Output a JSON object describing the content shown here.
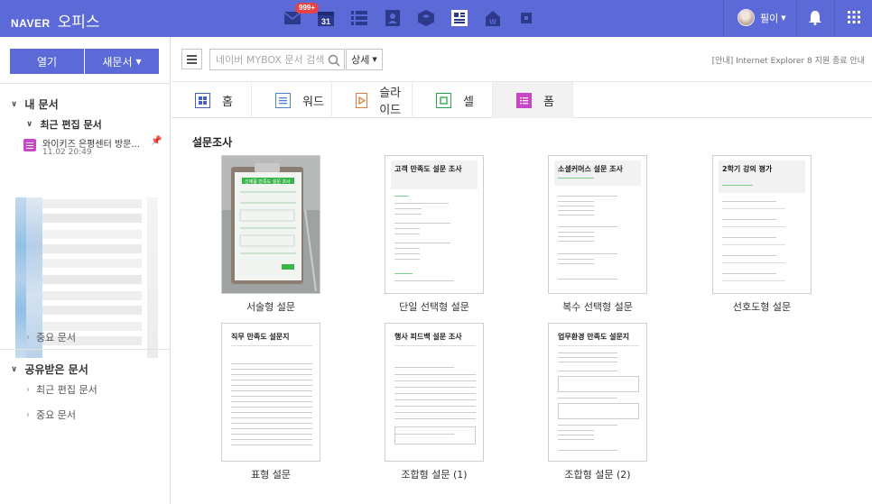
{
  "topbar": {
    "brand": "NAVER",
    "product": "오피스",
    "mail_badge": "999+",
    "calendar_day": "31",
    "username": "필이",
    "apps": [
      "mail-icon",
      "calendar-icon",
      "memo-icon",
      "contacts-icon",
      "mybox-icon",
      "office-icon",
      "works-icon",
      "more-apps-icon"
    ],
    "colors": {
      "bar": "#5b6ad6",
      "badge": "#e84242"
    }
  },
  "sidebar": {
    "open_label": "열기",
    "new_label": "새문서",
    "my_docs": "내 문서",
    "recent_edited": "최근 편집 문서",
    "recent_item": {
      "name": "와이키즈 은평센터 방문...",
      "date": "11.02 20:49"
    },
    "important_docs": "중요 문서",
    "shared_docs": "공유받은 문서",
    "shared_recent": "최근 편집 문서",
    "shared_important": "중요 문서"
  },
  "toolbar": {
    "search_placeholder": "네이버 MYBOX 문서 검색",
    "detail_label": "상세",
    "notice": "[안내] Internet Explorer 8 지원 종료 안내"
  },
  "tabs": [
    {
      "label": "홈",
      "icon": "home-icon",
      "color": "#4a5fc1"
    },
    {
      "label": "워드",
      "icon": "word-icon",
      "color": "#4a83d4"
    },
    {
      "label": "슬라이드",
      "icon": "slide-icon",
      "color": "#e0793b"
    },
    {
      "label": "셀",
      "icon": "cell-icon",
      "color": "#27a34a"
    },
    {
      "label": "폼",
      "icon": "form-icon",
      "color": "#c847c9"
    }
  ],
  "content": {
    "category": "설문조사",
    "templates": [
      {
        "label": "서술형 설문",
        "thumb_title": "신제품 만족도 설문 조사"
      },
      {
        "label": "단일 선택형 설문",
        "thumb_title": "고객 만족도 설문 조사"
      },
      {
        "label": "복수 선택형 설문",
        "thumb_title": "소셜커머스 설문 조사"
      },
      {
        "label": "선호도형 설문",
        "thumb_title": "2학기 강의 평가"
      },
      {
        "label": "표형 설문",
        "thumb_title": "직무 만족도 설문지"
      },
      {
        "label": "조합형 설문 (1)",
        "thumb_title": "행사 피드백 설문 조사"
      },
      {
        "label": "조합형 설문 (2)",
        "thumb_title": "업무환경 만족도 설문지"
      }
    ]
  }
}
